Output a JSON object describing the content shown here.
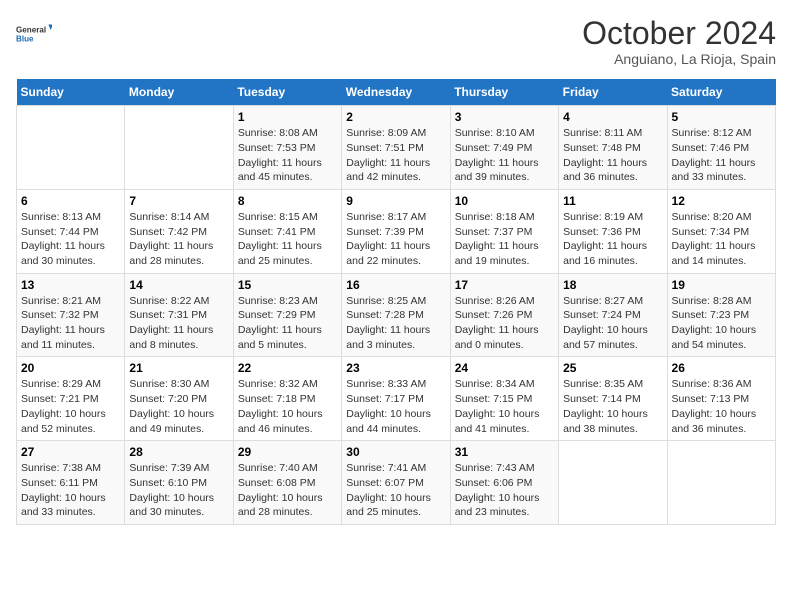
{
  "header": {
    "logo_line1": "General",
    "logo_line2": "Blue",
    "month": "October 2024",
    "location": "Anguiano, La Rioja, Spain"
  },
  "weekdays": [
    "Sunday",
    "Monday",
    "Tuesday",
    "Wednesday",
    "Thursday",
    "Friday",
    "Saturday"
  ],
  "weeks": [
    [
      {
        "day": "",
        "info": ""
      },
      {
        "day": "",
        "info": ""
      },
      {
        "day": "1",
        "info": "Sunrise: 8:08 AM\nSunset: 7:53 PM\nDaylight: 11 hours and 45 minutes."
      },
      {
        "day": "2",
        "info": "Sunrise: 8:09 AM\nSunset: 7:51 PM\nDaylight: 11 hours and 42 minutes."
      },
      {
        "day": "3",
        "info": "Sunrise: 8:10 AM\nSunset: 7:49 PM\nDaylight: 11 hours and 39 minutes."
      },
      {
        "day": "4",
        "info": "Sunrise: 8:11 AM\nSunset: 7:48 PM\nDaylight: 11 hours and 36 minutes."
      },
      {
        "day": "5",
        "info": "Sunrise: 8:12 AM\nSunset: 7:46 PM\nDaylight: 11 hours and 33 minutes."
      }
    ],
    [
      {
        "day": "6",
        "info": "Sunrise: 8:13 AM\nSunset: 7:44 PM\nDaylight: 11 hours and 30 minutes."
      },
      {
        "day": "7",
        "info": "Sunrise: 8:14 AM\nSunset: 7:42 PM\nDaylight: 11 hours and 28 minutes."
      },
      {
        "day": "8",
        "info": "Sunrise: 8:15 AM\nSunset: 7:41 PM\nDaylight: 11 hours and 25 minutes."
      },
      {
        "day": "9",
        "info": "Sunrise: 8:17 AM\nSunset: 7:39 PM\nDaylight: 11 hours and 22 minutes."
      },
      {
        "day": "10",
        "info": "Sunrise: 8:18 AM\nSunset: 7:37 PM\nDaylight: 11 hours and 19 minutes."
      },
      {
        "day": "11",
        "info": "Sunrise: 8:19 AM\nSunset: 7:36 PM\nDaylight: 11 hours and 16 minutes."
      },
      {
        "day": "12",
        "info": "Sunrise: 8:20 AM\nSunset: 7:34 PM\nDaylight: 11 hours and 14 minutes."
      }
    ],
    [
      {
        "day": "13",
        "info": "Sunrise: 8:21 AM\nSunset: 7:32 PM\nDaylight: 11 hours and 11 minutes."
      },
      {
        "day": "14",
        "info": "Sunrise: 8:22 AM\nSunset: 7:31 PM\nDaylight: 11 hours and 8 minutes."
      },
      {
        "day": "15",
        "info": "Sunrise: 8:23 AM\nSunset: 7:29 PM\nDaylight: 11 hours and 5 minutes."
      },
      {
        "day": "16",
        "info": "Sunrise: 8:25 AM\nSunset: 7:28 PM\nDaylight: 11 hours and 3 minutes."
      },
      {
        "day": "17",
        "info": "Sunrise: 8:26 AM\nSunset: 7:26 PM\nDaylight: 11 hours and 0 minutes."
      },
      {
        "day": "18",
        "info": "Sunrise: 8:27 AM\nSunset: 7:24 PM\nDaylight: 10 hours and 57 minutes."
      },
      {
        "day": "19",
        "info": "Sunrise: 8:28 AM\nSunset: 7:23 PM\nDaylight: 10 hours and 54 minutes."
      }
    ],
    [
      {
        "day": "20",
        "info": "Sunrise: 8:29 AM\nSunset: 7:21 PM\nDaylight: 10 hours and 52 minutes."
      },
      {
        "day": "21",
        "info": "Sunrise: 8:30 AM\nSunset: 7:20 PM\nDaylight: 10 hours and 49 minutes."
      },
      {
        "day": "22",
        "info": "Sunrise: 8:32 AM\nSunset: 7:18 PM\nDaylight: 10 hours and 46 minutes."
      },
      {
        "day": "23",
        "info": "Sunrise: 8:33 AM\nSunset: 7:17 PM\nDaylight: 10 hours and 44 minutes."
      },
      {
        "day": "24",
        "info": "Sunrise: 8:34 AM\nSunset: 7:15 PM\nDaylight: 10 hours and 41 minutes."
      },
      {
        "day": "25",
        "info": "Sunrise: 8:35 AM\nSunset: 7:14 PM\nDaylight: 10 hours and 38 minutes."
      },
      {
        "day": "26",
        "info": "Sunrise: 8:36 AM\nSunset: 7:13 PM\nDaylight: 10 hours and 36 minutes."
      }
    ],
    [
      {
        "day": "27",
        "info": "Sunrise: 7:38 AM\nSunset: 6:11 PM\nDaylight: 10 hours and 33 minutes."
      },
      {
        "day": "28",
        "info": "Sunrise: 7:39 AM\nSunset: 6:10 PM\nDaylight: 10 hours and 30 minutes."
      },
      {
        "day": "29",
        "info": "Sunrise: 7:40 AM\nSunset: 6:08 PM\nDaylight: 10 hours and 28 minutes."
      },
      {
        "day": "30",
        "info": "Sunrise: 7:41 AM\nSunset: 6:07 PM\nDaylight: 10 hours and 25 minutes."
      },
      {
        "day": "31",
        "info": "Sunrise: 7:43 AM\nSunset: 6:06 PM\nDaylight: 10 hours and 23 minutes."
      },
      {
        "day": "",
        "info": ""
      },
      {
        "day": "",
        "info": ""
      }
    ]
  ]
}
